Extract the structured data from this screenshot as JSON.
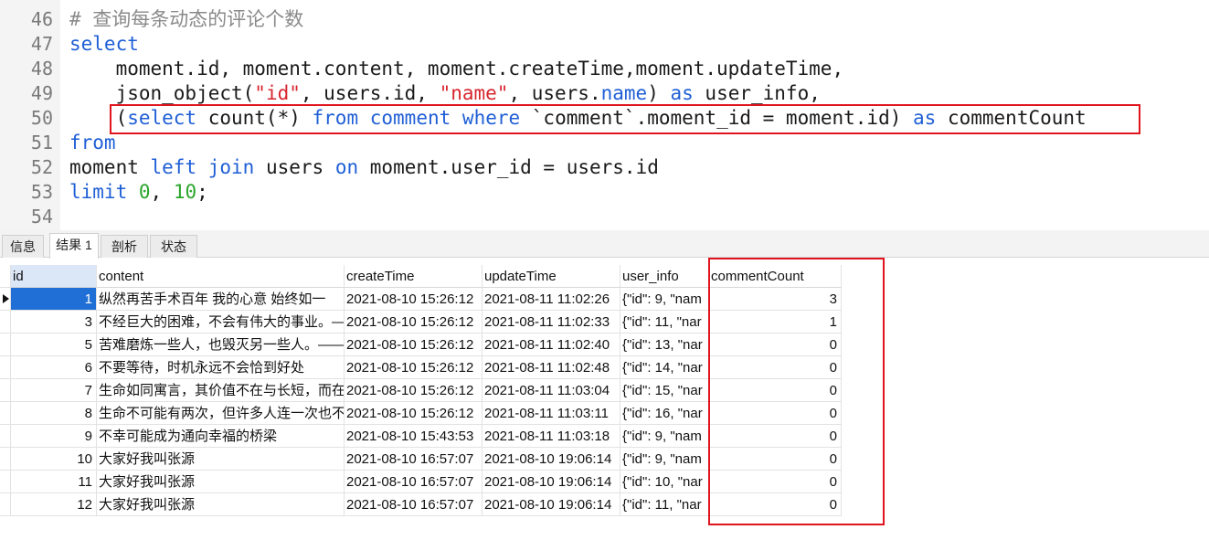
{
  "editor": {
    "lines": [
      {
        "n": "46",
        "tokens": [
          {
            "t": "# 查询每条动态的评论个数",
            "c": "cmt"
          }
        ]
      },
      {
        "n": "47",
        "tokens": [
          {
            "t": "select",
            "c": "kw"
          }
        ]
      },
      {
        "n": "48",
        "tokens": [
          {
            "t": "    moment.id, moment.content, moment.createTime,moment.updateTime,",
            "c": ""
          }
        ]
      },
      {
        "n": "49",
        "tokens": [
          {
            "t": "    json_object(",
            "c": ""
          },
          {
            "t": "\"id\"",
            "c": "str"
          },
          {
            "t": ", users.id, ",
            "c": ""
          },
          {
            "t": "\"name\"",
            "c": "str"
          },
          {
            "t": ", users.",
            "c": ""
          },
          {
            "t": "name",
            "c": "kw"
          },
          {
            "t": ") ",
            "c": ""
          },
          {
            "t": "as",
            "c": "kw"
          },
          {
            "t": " user_info,",
            "c": ""
          }
        ]
      },
      {
        "n": "50",
        "tokens": [
          {
            "t": "    (",
            "c": ""
          },
          {
            "t": "select",
            "c": "kw"
          },
          {
            "t": " count(*) ",
            "c": ""
          },
          {
            "t": "from",
            "c": "kw"
          },
          {
            "t": " ",
            "c": ""
          },
          {
            "t": "comment",
            "c": "kw"
          },
          {
            "t": " ",
            "c": ""
          },
          {
            "t": "where",
            "c": "kw"
          },
          {
            "t": " `comment`.moment_id = moment.id) ",
            "c": ""
          },
          {
            "t": "as",
            "c": "kw"
          },
          {
            "t": " commentCount",
            "c": ""
          }
        ]
      },
      {
        "n": "51",
        "tokens": [
          {
            "t": "from",
            "c": "kw"
          }
        ]
      },
      {
        "n": "52",
        "tokens": [
          {
            "t": "moment ",
            "c": ""
          },
          {
            "t": "left",
            "c": "kw"
          },
          {
            "t": " ",
            "c": ""
          },
          {
            "t": "join",
            "c": "kw"
          },
          {
            "t": " users ",
            "c": ""
          },
          {
            "t": "on",
            "c": "kw"
          },
          {
            "t": " moment.user_id = users.id",
            "c": ""
          }
        ]
      },
      {
        "n": "53",
        "tokens": [
          {
            "t": "limit",
            "c": "kw"
          },
          {
            "t": " ",
            "c": ""
          },
          {
            "t": "0",
            "c": "num"
          },
          {
            "t": ", ",
            "c": ""
          },
          {
            "t": "10",
            "c": "num"
          },
          {
            "t": ";",
            "c": ""
          }
        ]
      },
      {
        "n": "54",
        "tokens": []
      }
    ]
  },
  "tabs": [
    {
      "label": "信息",
      "active": false
    },
    {
      "label": "结果 1",
      "active": true
    },
    {
      "label": "剖析",
      "active": false
    },
    {
      "label": "状态",
      "active": false
    }
  ],
  "grid": {
    "columns": [
      "id",
      "content",
      "createTime",
      "updateTime",
      "user_info",
      "commentCount"
    ],
    "rows": [
      [
        "1",
        "纵然再苦手术百年 我的心意 始终如一",
        "2021-08-10 15:26:12",
        "2021-08-11 11:02:26",
        "{\"id\": 9, \"nam",
        "3"
      ],
      [
        "3",
        "不经巨大的困难，不会有伟大的事业。—",
        "2021-08-10 15:26:12",
        "2021-08-11 11:02:33",
        "{\"id\": 11, \"nar",
        "1"
      ],
      [
        "5",
        "苦难磨炼一些人，也毁灭另一些人。——",
        "2021-08-10 15:26:12",
        "2021-08-11 11:02:40",
        "{\"id\": 13, \"nar",
        "0"
      ],
      [
        "6",
        "不要等待，时机永远不会恰到好处",
        "2021-08-10 15:26:12",
        "2021-08-11 11:02:48",
        "{\"id\": 14, \"nar",
        "0"
      ],
      [
        "7",
        "生命如同寓言，其价值不在与长短，而在",
        "2021-08-10 15:26:12",
        "2021-08-11 11:03:04",
        "{\"id\": 15, \"nar",
        "0"
      ],
      [
        "8",
        "生命不可能有两次，但许多人连一次也不",
        "2021-08-10 15:26:12",
        "2021-08-11 11:03:11",
        "{\"id\": 16, \"nar",
        "0"
      ],
      [
        "9",
        "不幸可能成为通向幸福的桥梁",
        "2021-08-10 15:43:53",
        "2021-08-11 11:03:18",
        "{\"id\": 9, \"nam",
        "0"
      ],
      [
        "10",
        "大家好我叫张源",
        "2021-08-10 16:57:07",
        "2021-08-10 19:06:14",
        "{\"id\": 9, \"nam",
        "0"
      ],
      [
        "11",
        "大家好我叫张源",
        "2021-08-10 16:57:07",
        "2021-08-10 19:06:14",
        "{\"id\": 10, \"nar",
        "0"
      ],
      [
        "12",
        "大家好我叫张源",
        "2021-08-10 16:57:07",
        "2021-08-10 19:06:14",
        "{\"id\": 11, \"nar",
        "0"
      ]
    ]
  },
  "colors": {
    "keyword": "#1f5fd6",
    "string": "#d7262f",
    "number": "#2aa62a",
    "comment": "#8a8a8a",
    "highlight_box": "#e0141e",
    "selected_cell": "#1f6fd6"
  }
}
